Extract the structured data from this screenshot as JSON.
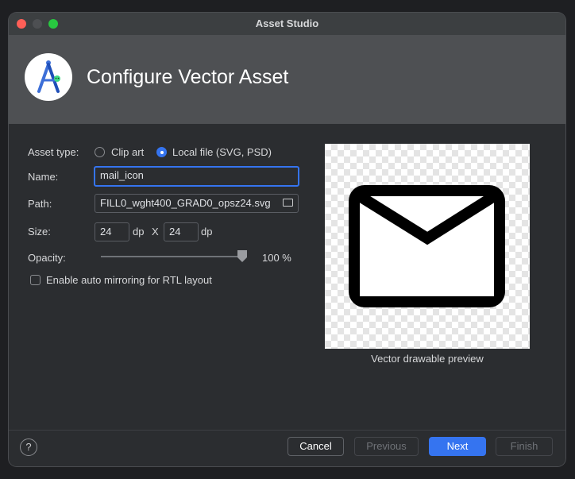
{
  "window": {
    "title": "Asset Studio"
  },
  "banner": {
    "title": "Configure Vector Asset",
    "logo_icon": "android-studio-logo-icon"
  },
  "form": {
    "asset_type_label": "Asset type:",
    "asset_type_options": [
      "Clip art",
      "Local file (SVG, PSD)"
    ],
    "asset_type_selected": "Local file (SVG, PSD)",
    "name_label": "Name:",
    "name_value": "mail_icon",
    "path_label": "Path:",
    "path_value": "FILL0_wght400_GRAD0_opsz24.svg",
    "size_label": "Size:",
    "size_width": "24",
    "size_height": "24",
    "size_unit": "dp",
    "size_separator": "X",
    "opacity_label": "Opacity:",
    "opacity_value": "100 %",
    "opacity_fraction": 1.0,
    "auto_mirror_label": "Enable auto mirroring for RTL layout",
    "auto_mirror_checked": false
  },
  "preview": {
    "caption": "Vector drawable preview",
    "icon": "mail-icon"
  },
  "footer": {
    "help_label": "?",
    "cancel": "Cancel",
    "previous": "Previous",
    "next": "Next",
    "finish": "Finish"
  },
  "colors": {
    "accent": "#3574f0",
    "background": "#2b2d30",
    "banner": "#4e5053"
  }
}
